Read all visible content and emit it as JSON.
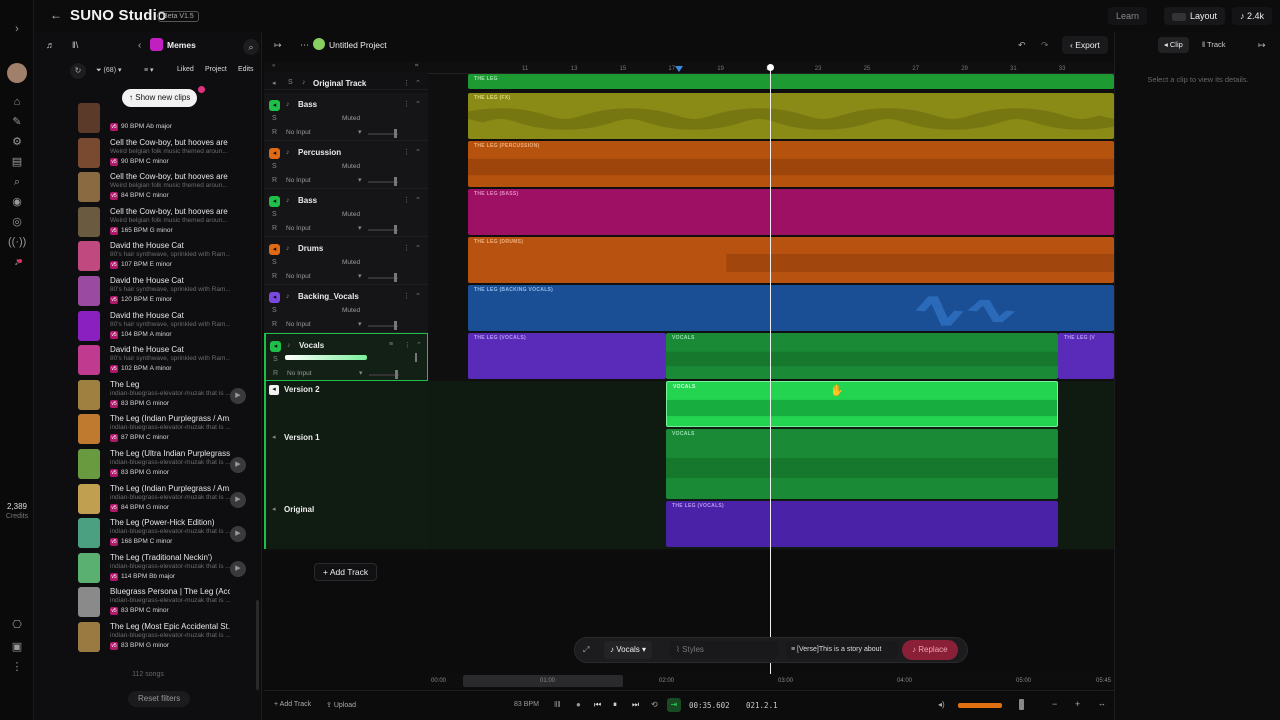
{
  "app": {
    "title": "SUNO Studio",
    "beta": "Beta V1.5"
  },
  "top": {
    "learn": "Learn",
    "layout": "Layout",
    "likes": "2.4k"
  },
  "rail": {
    "credits_value": "2,389",
    "credits_label": "Credits"
  },
  "library": {
    "workspace": "Memes",
    "filter_count": "68",
    "tabs": [
      "Liked",
      "Project",
      "Edits"
    ],
    "show_new": "Show new clips",
    "songs": [
      {
        "title": "",
        "sub": "",
        "bpm": "90 BPM",
        "key": "Ab major",
        "color": "#5b3a2a"
      },
      {
        "title": "Cell the Cow-boy, but hooves are ...",
        "sub": "Weird belgian folk music themed aroun...",
        "bpm": "90 BPM",
        "key": "C minor",
        "color": "#7a4a30"
      },
      {
        "title": "Cell the Cow-boy, but hooves are ...",
        "sub": "Weird belgian folk music themed aroun...",
        "bpm": "84 BPM",
        "key": "C minor",
        "color": "#8a6a40"
      },
      {
        "title": "Cell the Cow-boy, but hooves are ...",
        "sub": "Weird belgian folk music themed aroun...",
        "bpm": "165 BPM",
        "key": "G minor",
        "color": "#6a5a40"
      },
      {
        "title": "David the House Cat",
        "sub": "80's hair synthwave, sprinkled with Ram...",
        "bpm": "107 BPM",
        "key": "E minor",
        "color": "#c04a80"
      },
      {
        "title": "David the House Cat",
        "sub": "80's hair synthwave, sprinkled with Ram...",
        "bpm": "120 BPM",
        "key": "E minor",
        "color": "#9a4aa0"
      },
      {
        "title": "David the House Cat",
        "sub": "80's hair synthwave, sprinkled with Ram...",
        "bpm": "104 BPM",
        "key": "A minor",
        "color": "#8a20c0"
      },
      {
        "title": "David the House Cat",
        "sub": "80's hair synthwave, sprinkled with Ram...",
        "bpm": "102 BPM",
        "key": "A minor",
        "color": "#c03a90"
      },
      {
        "title": "The Leg",
        "sub": "indian-bluegrass-elevator-muzak that is ...",
        "bpm": "83 BPM",
        "key": "G minor",
        "color": "#a08040"
      },
      {
        "title": "The Leg (Indian Purplegrass / Am...",
        "sub": "indian-bluegrass-elevator-muzak that is ...",
        "bpm": "87 BPM",
        "key": "C minor",
        "color": "#c07a30"
      },
      {
        "title": "The Leg (Ultra Indian Purplegrass ...",
        "sub": "indian-bluegrass-elevator-muzak that is ...",
        "bpm": "83 BPM",
        "key": "G minor",
        "color": "#6a9a40"
      },
      {
        "title": "The Leg (Indian Purplegrass / Am...",
        "sub": "indian-bluegrass-elevator-muzak that is ...",
        "bpm": "84 BPM",
        "key": "G minor",
        "color": "#c0a050"
      },
      {
        "title": "The Leg (Power-Hick Edition)",
        "sub": "indian-bluegrass-elevator-muzak that is ...",
        "bpm": "168 BPM",
        "key": "C minor",
        "color": "#4aa080"
      },
      {
        "title": "The Leg (Traditional Neckin')",
        "sub": "indian-bluegrass-elevator-muzak that is ...",
        "bpm": "114 BPM",
        "key": "Bb major",
        "color": "#5ab070"
      },
      {
        "title": "Bluegrass Persona | The Leg (Acc...",
        "sub": "indian-bluegrass-elevator-muzak that is ...",
        "bpm": "83 BPM",
        "key": "C minor",
        "color": "#8a8a8a"
      },
      {
        "title": "The Leg (Most Epic Accidental St...",
        "sub": "indian-bluegrass-elevator-muzak that is ...",
        "bpm": "83 BPM",
        "key": "G minor",
        "color": "#9a7a40"
      }
    ],
    "count": "112 songs",
    "reset": "Reset filters"
  },
  "project": {
    "name": "Untitled Project",
    "export": "Export",
    "clip": "Clip",
    "track": "Track",
    "right_hint": "Select a clip to view its details."
  },
  "tracks": [
    {
      "name": "Bass",
      "color": "#1fc04a",
      "muted": "Muted",
      "input": "No Input"
    },
    {
      "name": "Percussion",
      "color": "#e06a14",
      "muted": "Muted",
      "input": "No Input"
    },
    {
      "name": "Bass",
      "color": "#1fc04a",
      "muted": "Muted",
      "input": "No Input"
    },
    {
      "name": "Drums",
      "color": "#e06a14",
      "muted": "Muted",
      "input": "No Input"
    },
    {
      "name": "Backing_Vocals",
      "color": "#7a4ae0",
      "muted": "Muted",
      "input": "No Input"
    },
    {
      "name": "Vocals",
      "color": "#1fc04a",
      "muted": "",
      "input": "No Input"
    }
  ],
  "original_track": "Original Track",
  "versions": {
    "v2": "Version 2",
    "v1": "Version 1",
    "orig": "Original"
  },
  "add_track": "Add Track",
  "lanes": {
    "orig": "THE LEG",
    "fx": "THE LEG (FX)",
    "perc": "THE LEG (PERCUSSION)",
    "bass": "THE LEG (BASS)",
    "drums": "THE LEG (DRUMS)",
    "bv": "THE LEG (BACKING VOCALS)",
    "voc": "THE LEG (VOCALS)",
    "voc_short": "THE LEG (V",
    "vocals": "VOCALS"
  },
  "ruler_ticks": [
    "11",
    "13",
    "15",
    "17",
    "19",
    "21",
    "23",
    "25",
    "27",
    "29",
    "31",
    "33"
  ],
  "prompt": {
    "stem": "Vocals",
    "styles": "Styles",
    "lyrics": "[Verse]This is a story about",
    "replace": "Replace"
  },
  "timeline_bottom": [
    "00:00",
    "01:00",
    "02:00",
    "03:00",
    "04:00",
    "05:00",
    "05:45"
  ],
  "transport": {
    "add_track": "Add Track",
    "upload": "Upload",
    "bpm": "83 BPM",
    "time": "00:35.602",
    "bar": "021.2.1"
  }
}
